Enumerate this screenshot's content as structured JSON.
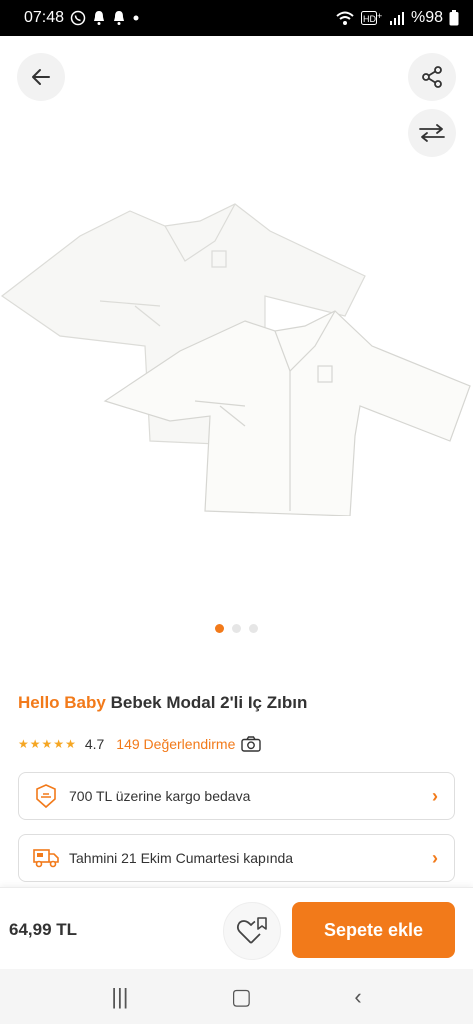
{
  "status_bar": {
    "time": "07:48",
    "battery": "%98",
    "icons": [
      "whatsapp-icon",
      "bell-icon",
      "bell-icon",
      "dot-icon",
      "wifi-icon",
      "hd-icon",
      "signal-icon",
      "battery-icon"
    ]
  },
  "toolbar": {
    "icons": [
      "back-arrow-icon",
      "share-icon",
      "compare-icon"
    ]
  },
  "carousel": {
    "active_index": 0,
    "count": 3
  },
  "product": {
    "brand": "Hello Baby",
    "name": "Bebek Modal 2'li Iç Zıbın",
    "rating": "4.7",
    "rating_stars": 4.7,
    "reviews": "149 Değerlendirme"
  },
  "info_cards": {
    "cargo": "700 TL üzerine kargo bedava",
    "delivery": "Tahmini 21 Ekim Cumartesi kapında"
  },
  "bottom_bar": {
    "price": "64,99 TL",
    "add_to_cart": "Sepete ekle"
  },
  "colors": {
    "accent": "#f27a1a",
    "star": "#f5a623"
  }
}
